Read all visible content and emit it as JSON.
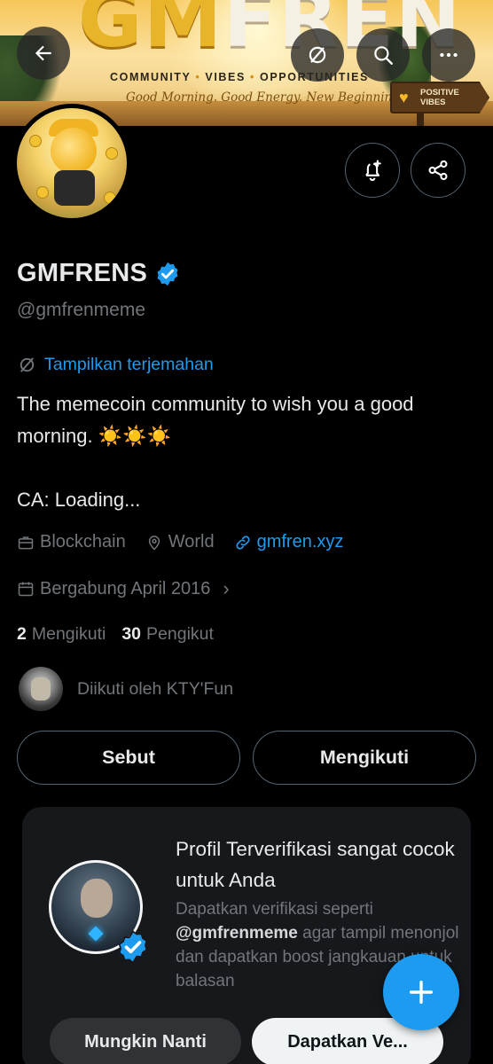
{
  "banner": {
    "brand_part1": "GM",
    "brand_part2": "FREN",
    "tagline_1": "COMMUNITY",
    "tagline_2": "VIBES",
    "tagline_3": "OPPORTUNITIES",
    "tagline_sep": "•",
    "subline": "Good Morning. Good Energy. New Beginnings.",
    "sign_line1": "POSITIVE",
    "sign_line2": "VIBES"
  },
  "header_buttons": {
    "back_icon": "arrow-left-icon",
    "grok_icon": "slash-circle-icon",
    "search_icon": "search-icon",
    "more_icon": "more-horizontal-icon"
  },
  "actions": {
    "notify_icon": "bell-plus-icon",
    "share_icon": "share-icon"
  },
  "profile": {
    "display_name": "GMFRENS",
    "handle": "@gmfrenmeme",
    "translate_label": "Tampilkan terjemahan",
    "bio": "The memecoin community to wish you a good morning. ☀️☀️☀️\n\nCA: Loading...",
    "category": "Blockchain",
    "location": "World",
    "website": "gmfren.xyz",
    "joined": "Bergabung April 2016",
    "joined_chevron": "›",
    "following_count": "2",
    "following_label": "Mengikuti",
    "followers_count": "30",
    "followers_label": "Pengikut",
    "followed_by": "Diikuti oleh KTY'Fun"
  },
  "buttons": {
    "mention": "Sebut",
    "following": "Mengikuti"
  },
  "promo": {
    "title": "Profil Terverifikasi sangat cocok untuk Anda",
    "desc_before": "Dapatkan verifikasi seperti ",
    "desc_handle": "@gmfrenmeme",
    "desc_after": " agar tampil menonjol dan dapatkan boost jangkauan untuk balasan",
    "later_label": "Mungkin Nanti",
    "get_label": "Dapatkan Ve..."
  },
  "colors": {
    "accent": "#1d9bf0",
    "background": "#000000",
    "muted_text": "#71767b",
    "card": "#16181c"
  }
}
